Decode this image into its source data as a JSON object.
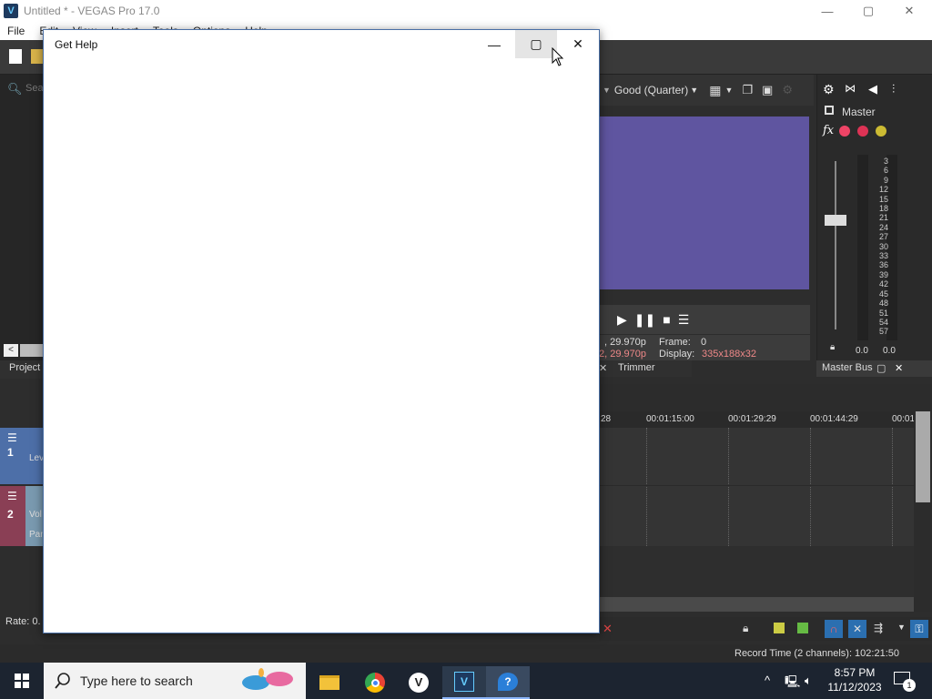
{
  "window": {
    "title": "Untitled * - VEGAS Pro 17.0",
    "app_icon_letter": "V",
    "minimize": "—",
    "maximize": "▢",
    "close": "✕"
  },
  "menu": [
    "File",
    "Edit",
    "View",
    "Insert",
    "Tools",
    "Options",
    "Help"
  ],
  "explorer": {
    "search_placeholder": "Sea",
    "project_tab": "Project"
  },
  "preview": {
    "quality": "Good (Quarter)",
    "info_line1_left": ", 29.970p",
    "info_line2_left": "2, 29.970p",
    "frame_label": "Frame:",
    "frame_value": "0",
    "display_label": "Display:",
    "display_value": "335x188x32",
    "trimmer_tab": "Trimmer"
  },
  "master": {
    "label": "Master",
    "scale": [
      "3",
      "6",
      "9",
      "12",
      "15",
      "18",
      "21",
      "24",
      "27",
      "30",
      "33",
      "36",
      "39",
      "42",
      "45",
      "48",
      "51",
      "54",
      "57"
    ],
    "left_value": "0.0",
    "right_value": "0.0",
    "bus_tab": "Master Bus"
  },
  "timeline": {
    "ruler": [
      "28",
      "00:01:15:00",
      "00:01:29:29",
      "00:01:44:29",
      "00:01"
    ]
  },
  "tracks": [
    {
      "number": "1",
      "label": "Lev",
      "color": "#4d6fa8"
    },
    {
      "number": "2",
      "label1": "Vol",
      "label2": "Pan",
      "color": "#8a3f55"
    }
  ],
  "rate_label": "Rate: 0.",
  "status": {
    "record_time": "Record Time (2 channels): 102:21:50"
  },
  "dialog": {
    "title": "Get Help"
  },
  "taskbar": {
    "search_placeholder": "Type here to search",
    "time": "8:57 PM",
    "date": "11/12/2023",
    "notification_count": "1"
  },
  "colors": {
    "accent": "#4a6fa5",
    "preview_video": "#5f55a0"
  }
}
